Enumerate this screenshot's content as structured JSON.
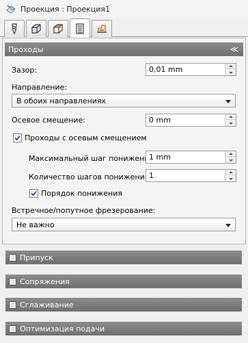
{
  "title": "Проекция : Проекция1",
  "tabs": [
    {
      "icon": "tool-icon",
      "active": false
    },
    {
      "icon": "stock-box-icon",
      "active": false
    },
    {
      "icon": "boundary-box-icon",
      "active": false
    },
    {
      "icon": "parameters-icon",
      "active": true
    },
    {
      "icon": "links-icon",
      "active": false
    }
  ],
  "passes": {
    "header": "Проходы",
    "collapse_symbol": "≪",
    "gap_label": "Зазор:",
    "gap_value": "0,01 mm",
    "direction_label": "Направление:",
    "direction_value": "В обоих направлениях",
    "axial_offset_label": "Осевое смещение:",
    "axial_offset_value": "0 mm",
    "axial_passes_label": "Проходы с осевым смещением",
    "axial_passes_checked": true,
    "max_stepdown_label": "Максимальный шаг понижения:",
    "max_stepdown_value": "1 mm",
    "stepdown_count_label": "Количество шагов понижения:",
    "stepdown_count_value": "1",
    "stepdown_order_label": "Порядок понижения",
    "stepdown_order_checked": true,
    "milling_label": "Встречное/попутное фрезерование:",
    "milling_value": "Не важно"
  },
  "sections": [
    {
      "label": "Припуск",
      "checked": false
    },
    {
      "label": "Сопряжения",
      "checked": false
    },
    {
      "label": "Сглаживание",
      "checked": false
    },
    {
      "label": "Оптимизация подачи",
      "checked": false
    }
  ],
  "colors": {
    "header_bg": "#7d7d7d",
    "panel_bg": "#f4f4f4",
    "window_bg": "#f0f0f0"
  }
}
